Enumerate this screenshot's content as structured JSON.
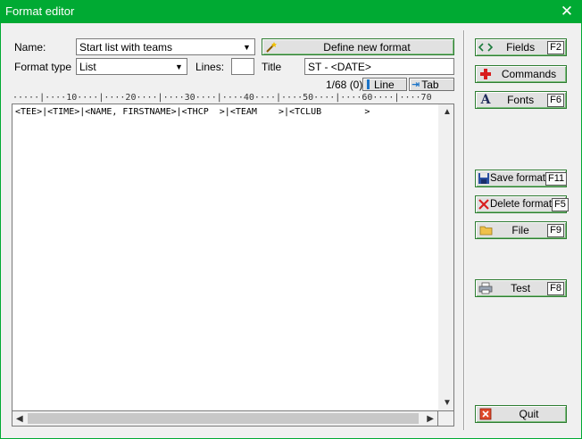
{
  "window": {
    "title": "Format editor",
    "close_glyph": "✕"
  },
  "form": {
    "name_label": "Name:",
    "name_value": "Start list with teams",
    "define_button": "Define new format",
    "format_type_label": "Format type",
    "format_type_value": "List",
    "lines_label": "Lines:",
    "lines_value": "",
    "title_label": "Title",
    "title_value": "ST - <DATE>",
    "position": "1/68 (0)",
    "line_button": "Line",
    "tab_button": "Tab"
  },
  "ruler": "·····|····10····|····20····|····30····|····40····|····50····|····60····|····70",
  "editor": {
    "content": "<TEE>|<TIME>|<NAME, FIRSTNAME>|<THCP  >|<TEAM    >|<TCLUB        >"
  },
  "sidebar": {
    "fields": {
      "label": "Fields",
      "key": "F2",
      "icon": "angle-brackets-icon"
    },
    "commands": {
      "label": "Commands",
      "icon": "red-cross-icon"
    },
    "fonts": {
      "label": "Fonts",
      "key": "F6",
      "icon": "letter-a-icon"
    },
    "save": {
      "label": "Save format",
      "key": "F11",
      "icon": "floppy-disk-icon"
    },
    "delete": {
      "label": "Delete format",
      "key": "F5",
      "icon": "red-x-icon"
    },
    "file": {
      "label": "File",
      "key": "F9",
      "icon": "folder-icon"
    },
    "test": {
      "label": "Test",
      "key": "F8",
      "icon": "printer-icon"
    },
    "quit": {
      "label": "Quit",
      "icon": "quit-icon"
    }
  },
  "colors": {
    "titlebar": "#00aa33",
    "accent_border": "#2e7d32"
  }
}
